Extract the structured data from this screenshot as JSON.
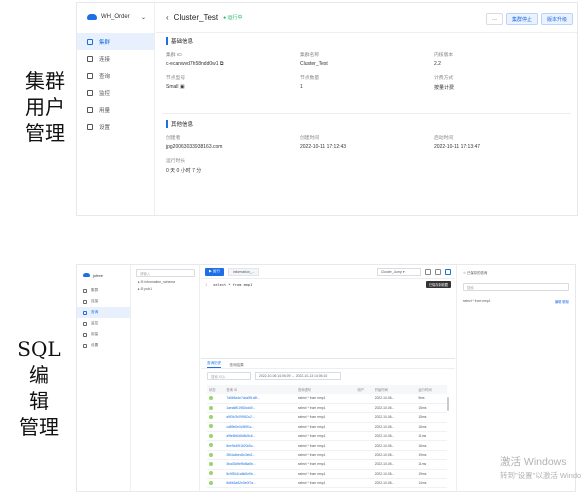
{
  "captions": {
    "top": [
      "集群",
      "用户",
      "管理"
    ],
    "bottom": [
      "SQL 编",
      "辑",
      "管理"
    ]
  },
  "cluster_page": {
    "brand": "WH_Order",
    "nav": [
      {
        "label": "集群",
        "icon": "cluster-icon",
        "active": true
      },
      {
        "label": "连接",
        "icon": "link-icon",
        "active": false
      },
      {
        "label": "查询",
        "icon": "document-icon",
        "active": false
      },
      {
        "label": "监控",
        "icon": "monitor-icon",
        "active": false
      },
      {
        "label": "用量",
        "icon": "usage-icon",
        "active": false
      },
      {
        "label": "设置",
        "icon": "gear-icon",
        "active": false
      }
    ],
    "title": "Cluster_Test",
    "status": "● 运行中",
    "buttons": {
      "more": "…",
      "pause": "集群停止",
      "upgrade": "版本升级"
    },
    "basic": {
      "title": "基础信息",
      "fields": [
        {
          "k": "集群 ID",
          "v": "c-ecanwvd7h58ndd0w1 ⧉"
        },
        {
          "k": "集群名称",
          "v": "Cluster_Test"
        },
        {
          "k": "内核版本",
          "v": "2.2"
        },
        {
          "k": "节点型号",
          "v": "Small ▣"
        },
        {
          "k": "节点数量",
          "v": "1"
        },
        {
          "k": "计费方式",
          "v": "按量计费"
        }
      ]
    },
    "other": {
      "title": "其他信息",
      "fields": [
        {
          "k": "创建者",
          "v": "jpg20063033938163.com"
        },
        {
          "k": "创建时间",
          "v": "2022-10-11 17:12:43"
        },
        {
          "k": "启动时间",
          "v": "2022-10-11 17:13:47"
        },
        {
          "k": "运行时长",
          "v": "0 天 0 小时 7 分"
        }
      ]
    }
  },
  "sql_page": {
    "brand": "jofree",
    "nav": [
      {
        "label": "集群",
        "active": false
      },
      {
        "label": "连接",
        "active": false
      },
      {
        "label": "查询",
        "active": true
      },
      {
        "label": "监控",
        "active": false
      },
      {
        "label": "用量",
        "active": false
      },
      {
        "label": "设置",
        "active": false
      }
    ],
    "tree_search": "请输入",
    "tree": [
      "▸ ⊟ information_schema",
      "▸ ⊟ pub1"
    ],
    "run": "▶ 运行",
    "tab": "information_...",
    "db_select": "Cluster_Jump ▾",
    "tooltip": "已保存到收藏",
    "code": "select * from emp1",
    "code_line": "1",
    "hist_tabs": [
      "查询历史",
      "查询结果"
    ],
    "hist_search": "搜索 SQL",
    "date_range": "2022-10-06 14:06:09  →  2022-10-13 14:06:10",
    "columns": [
      "状态",
      "查询 ID",
      "查询语句",
      "用户",
      "开始时间",
      "运行时间"
    ],
    "rows": [
      [
        "7d6b5a4e7cba9f1c8f...",
        "select * from emp1",
        "",
        "2022-10-06...",
        "9ms"
      ],
      [
        "1aea6f01980cdd0...",
        "select * from emp1",
        "",
        "2022-10-06...",
        "15ms"
      ],
      [
        "a9f3b7b099f10c2...",
        "select * from emp1",
        "",
        "2022-10-06...",
        "15ms"
      ],
      [
        "cd89b0e0c9f0f1c...",
        "select * from emp1",
        "",
        "2022-10-06...",
        "16ms"
      ],
      [
        "a9fe8b0d8d8c9c6...",
        "select * from emp1",
        "",
        "2022-10-06...",
        "11ms"
      ],
      [
        "8ee9e4f51620c5c...",
        "select * from emp1",
        "",
        "2022-10-06...",
        "16ms"
      ],
      [
        "2f64cdbec5c3eb2...",
        "select * from emp1",
        "",
        "2022-10-06...",
        "19ms"
      ],
      [
        "3ba03d9ef8d6a5b...",
        "select * from emp1",
        "",
        "2022-10-06...",
        "11ms"
      ],
      [
        "8c9f30d1a8d0e9b...",
        "select * from emp1",
        "",
        "2022-10-06...",
        "19ms"
      ],
      [
        "8d6b3a52e0e0f7a...",
        "select * from emp1",
        "",
        "2022-10-06...",
        "14ms"
      ]
    ],
    "right_title": "☆ 已保存的查询",
    "right_search": "搜索",
    "saved_query": "select * from emp1",
    "saved_actions": "编辑 删除"
  },
  "watermark": {
    "line1": "激活 Windows",
    "line2": "转到\"设置\"以激活 Windo"
  },
  "colors": {
    "accent": "#1e6fe6",
    "status_ok": "#25b864"
  }
}
